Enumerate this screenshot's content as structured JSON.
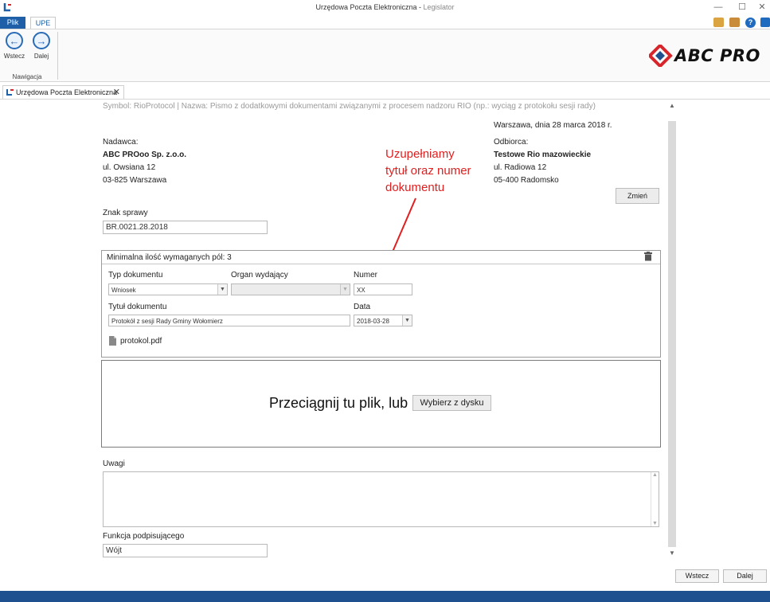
{
  "window": {
    "title": "Urzędowa Poczta Elektroniczna",
    "app_name": "Legislator",
    "title_separator": " - ",
    "controls": {
      "minimize": "—",
      "maximize": "☐",
      "close": "✕"
    }
  },
  "ribbon": {
    "tabs": [
      {
        "label": "Plik"
      },
      {
        "label": "UPE"
      }
    ],
    "nav_back_label": "Wstecz",
    "nav_next_label": "Dalej",
    "nav_group_label": "Nawigacja",
    "logo_text": "ABC PRO",
    "help_icon": "?"
  },
  "doc_tab": {
    "label": "Urzędowa Poczta Elektroniczna",
    "close": "✕"
  },
  "symbol_line": "Symbol: RioProtocol | Nazwa: Pismo z dodatkowymi dokumentami związanymi z procesem nadzoru RIO (np.: wyciąg z protokołu sesji rady)",
  "date_line": "Warszawa, dnia 28 marca 2018 r.",
  "sender": {
    "label": "Nadawca:",
    "name": "ABC PROoo Sp. z.o.o.",
    "street": "ul. Owsiana 12",
    "city": "03-825 Warszawa"
  },
  "recipient": {
    "label": "Odbiorca:",
    "name": "Testowe Rio mazowieckie",
    "street": "ul. Radiowa 12",
    "city": "05-400 Radomsko",
    "change_button": "Zmień"
  },
  "annotation": {
    "lines": [
      "Uzupełniamy",
      "tytuł oraz numer",
      "dokumentu"
    ],
    "color": "#e02020"
  },
  "case_ref": {
    "label": "Znak sprawy",
    "value": "BR.0021.28.2018"
  },
  "attachment_box": {
    "header": "Minimalna ilość wymaganych pól: 3",
    "doc_type_label": "Typ dokumentu",
    "doc_type_value": "Wniosek",
    "issuer_label": "Organ wydający",
    "issuer_value": "",
    "number_label": "Numer",
    "number_value": "XX",
    "title_label": "Tytuł dokumentu",
    "title_value": "Protokół z sesji Rady Gminy Wołomierz",
    "date_label": "Data",
    "date_value": "2018-03-28",
    "file_name": "protokol.pdf",
    "caret": "▼"
  },
  "dropzone": {
    "text": "Przeciągnij tu plik, lub",
    "button": "Wybierz z dysku"
  },
  "remarks": {
    "label": "Uwagi",
    "value": ""
  },
  "signer": {
    "label": "Funkcja podpisującego",
    "value": "Wójt"
  },
  "footer": {
    "back": "Wstecz",
    "next": "Dalej"
  },
  "colors": {
    "accent": "#1e5fa8",
    "annotation": "#e02020",
    "logo_red": "#d7262b"
  }
}
